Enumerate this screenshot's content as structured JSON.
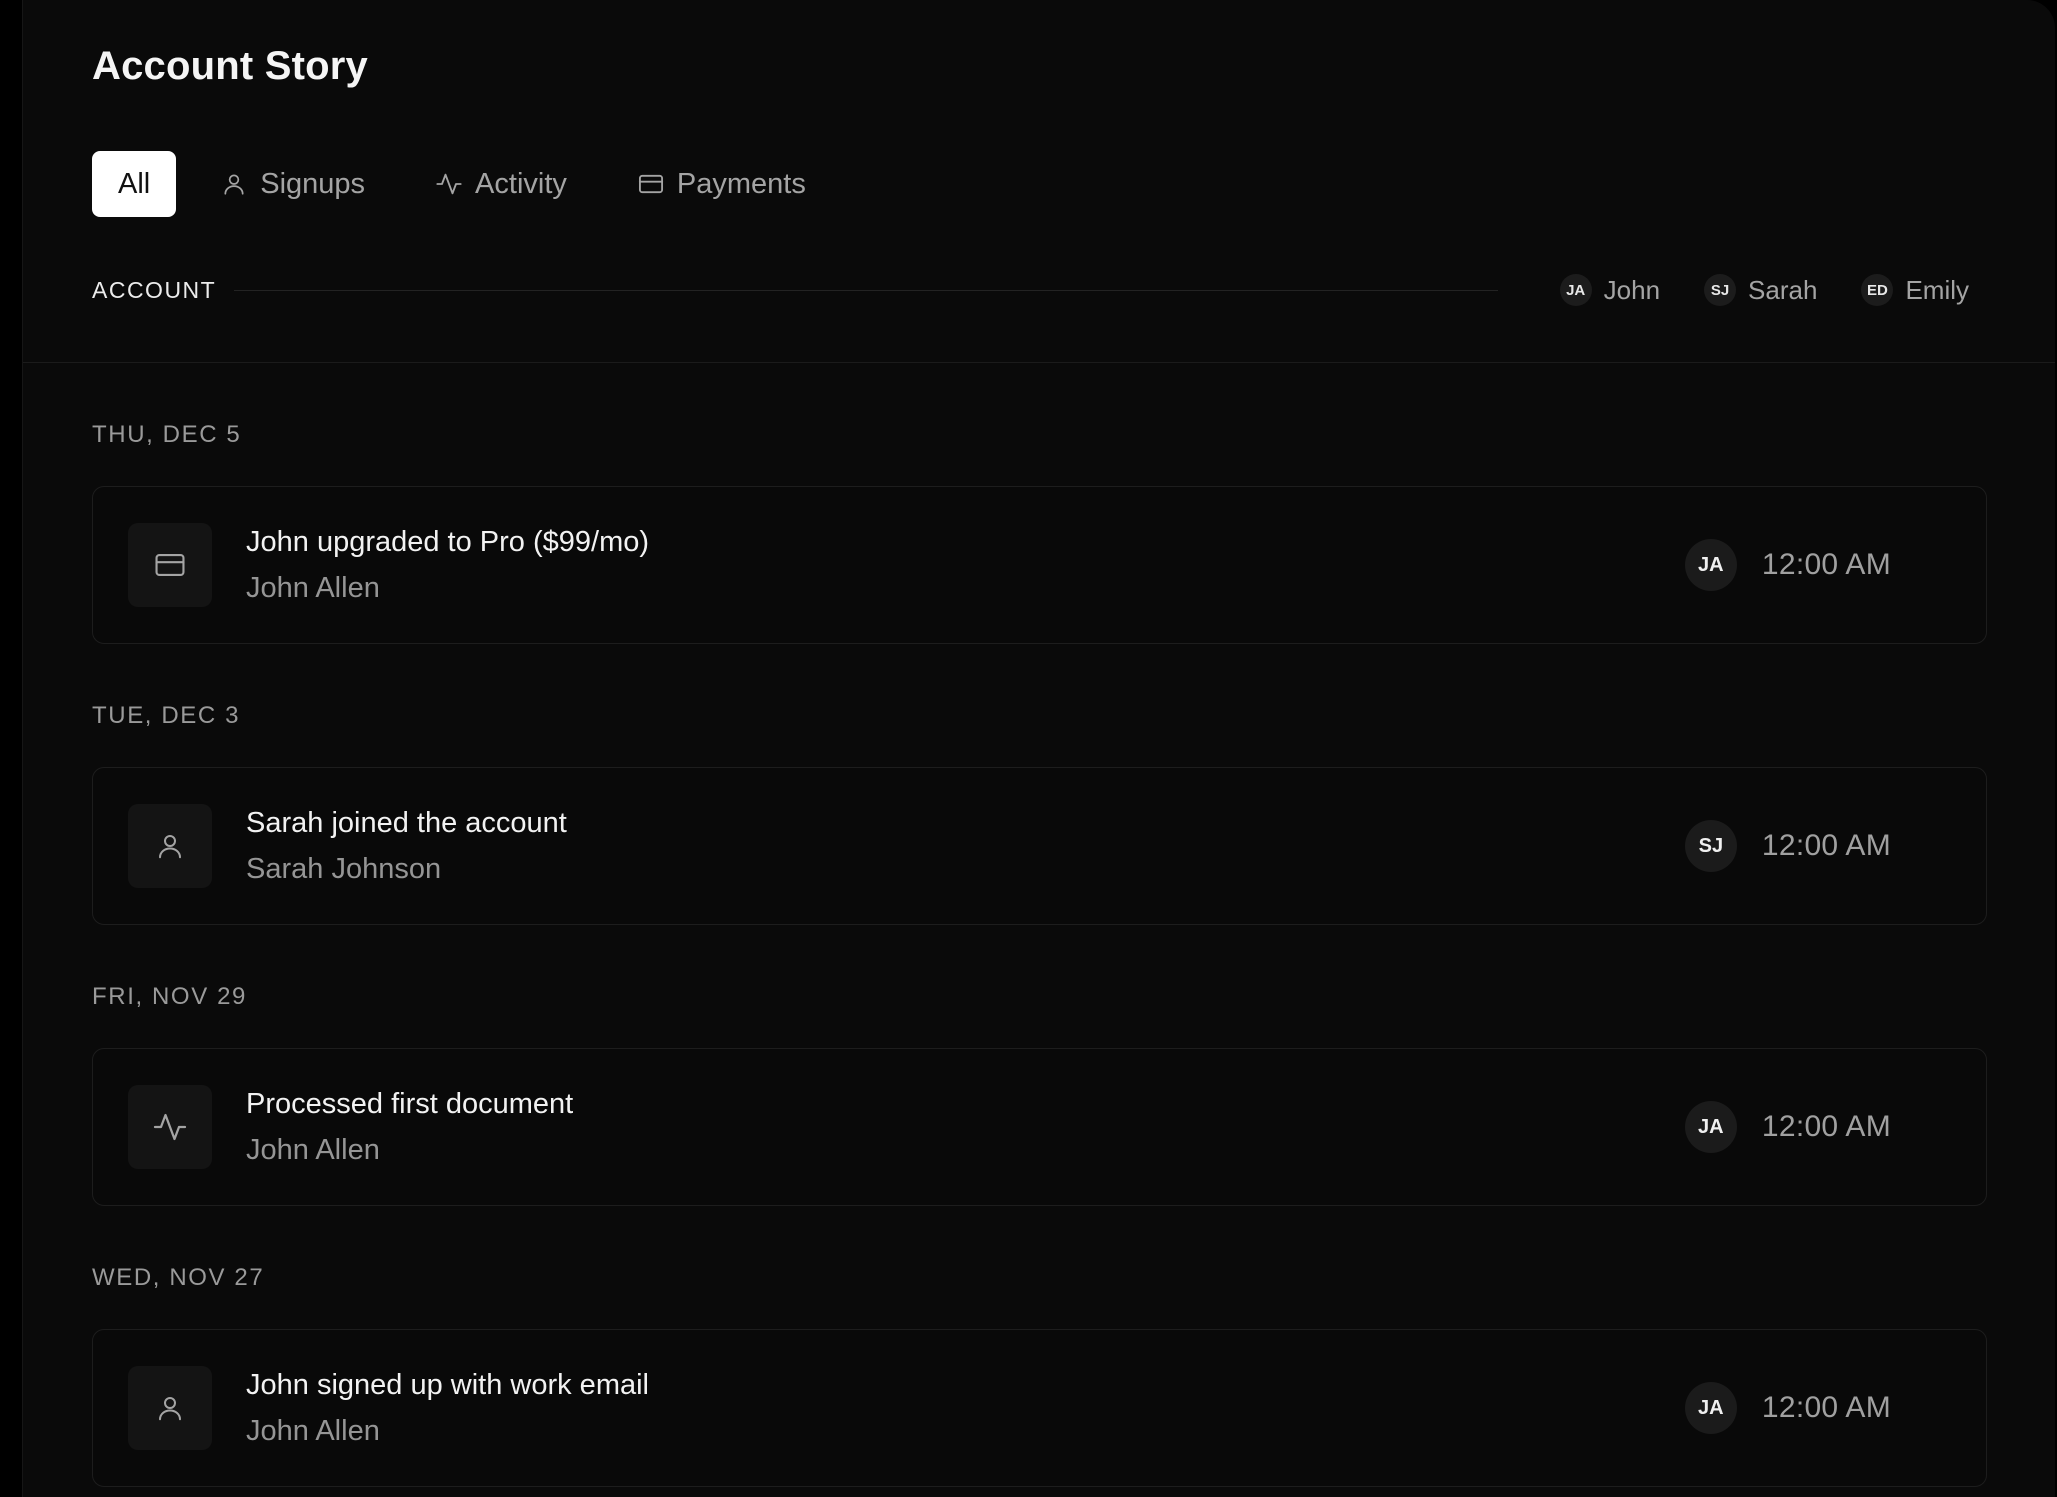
{
  "page": {
    "title": "Account Story"
  },
  "tabs": [
    {
      "label": "All",
      "icon": null,
      "active": true
    },
    {
      "label": "Signups",
      "icon": "user-icon",
      "active": false
    },
    {
      "label": "Activity",
      "icon": "activity-icon",
      "active": false
    },
    {
      "label": "Payments",
      "icon": "credit-card-icon",
      "active": false
    }
  ],
  "account": {
    "label": "ACCOUNT",
    "members": [
      {
        "initials": "JA",
        "name": "John"
      },
      {
        "initials": "SJ",
        "name": "Sarah"
      },
      {
        "initials": "ED",
        "name": "Emily"
      }
    ]
  },
  "days": [
    {
      "label": "THU, DEC 5",
      "event": {
        "icon": "credit-card-icon",
        "title": "John upgraded to Pro ($99/mo)",
        "person": "John Allen",
        "initials": "JA",
        "time": "12:00 AM"
      }
    },
    {
      "label": "TUE, DEC 3",
      "event": {
        "icon": "user-icon",
        "title": "Sarah joined the account",
        "person": "Sarah Johnson",
        "initials": "SJ",
        "time": "12:00 AM"
      }
    },
    {
      "label": "FRI, NOV 29",
      "event": {
        "icon": "activity-icon",
        "title": "Processed first document",
        "person": "John Allen",
        "initials": "JA",
        "time": "12:00 AM"
      }
    },
    {
      "label": "WED, NOV 27",
      "event": {
        "icon": "user-icon",
        "title": "John signed up with work email",
        "person": "John Allen",
        "initials": "JA",
        "time": "12:00 AM"
      }
    }
  ],
  "colors": {
    "background": "#0a0a0a",
    "active_tab_bg": "#ffffff",
    "muted_text": "#a4a4a4"
  }
}
